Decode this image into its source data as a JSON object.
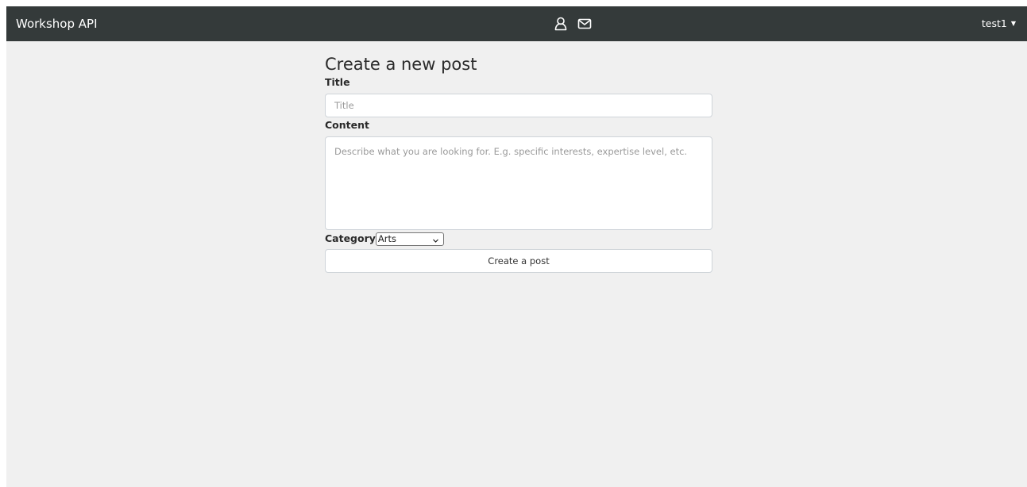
{
  "navbar": {
    "brand": "Workshop API",
    "icons": [
      "user-icon",
      "envelope-icon"
    ],
    "user": "test1",
    "bg_color": "#343a3a"
  },
  "form": {
    "heading": "Create a new post",
    "title_label": "Title",
    "title_placeholder": "Title",
    "title_value": "",
    "content_label": "Content",
    "content_placeholder": "Describe what you are looking for. E.g. specific interests, expertise level, etc.",
    "content_value": "",
    "category_label": "Category",
    "category_selected": "Arts",
    "submit_label": "Create a post"
  }
}
